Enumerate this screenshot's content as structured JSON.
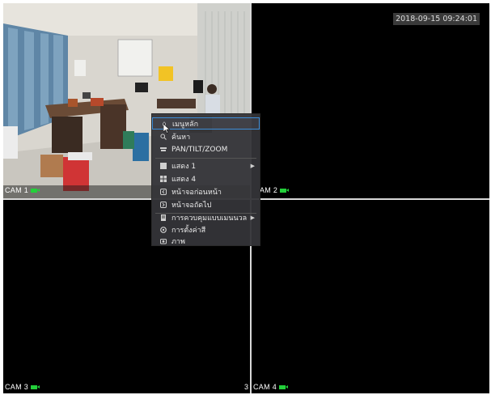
{
  "screen": {
    "timestamp": "2018-09-15 09:24:01"
  },
  "cells": [
    {
      "label": "CAM 1"
    },
    {
      "label": "AM 2"
    },
    {
      "label": "CAM 3"
    },
    {
      "label": "CAM 4"
    }
  ],
  "cell4_extra": "3",
  "context_menu": {
    "items": [
      {
        "label": "เมนูหลัก",
        "icon": "home-icon",
        "selected": true
      },
      {
        "label": "ค้นหา",
        "icon": "search-icon"
      },
      {
        "label": "PAN/TILT/ZOOM",
        "icon": "ptz-icon"
      },
      {
        "label": "แสดง 1",
        "icon": "single-view-icon",
        "submenu": true
      },
      {
        "label": "แสดง 4",
        "icon": "quad-view-icon"
      },
      {
        "label": "หน้าจอก่อนหน้า",
        "icon": "previous-screen-icon"
      },
      {
        "label": "หน้าจอถัดไป",
        "icon": "next-screen-icon"
      },
      {
        "label": "การควบคุมแบบเมนนวล",
        "icon": "manual-control-icon",
        "submenu": true
      },
      {
        "label": "การตั้งค่าสี",
        "icon": "color-setting-icon"
      },
      {
        "label": "ภาพ",
        "icon": "image-icon"
      }
    ]
  },
  "colors": {
    "cam_indicator": "#23d03a",
    "menu_selected_border": "#3e8ed8"
  }
}
